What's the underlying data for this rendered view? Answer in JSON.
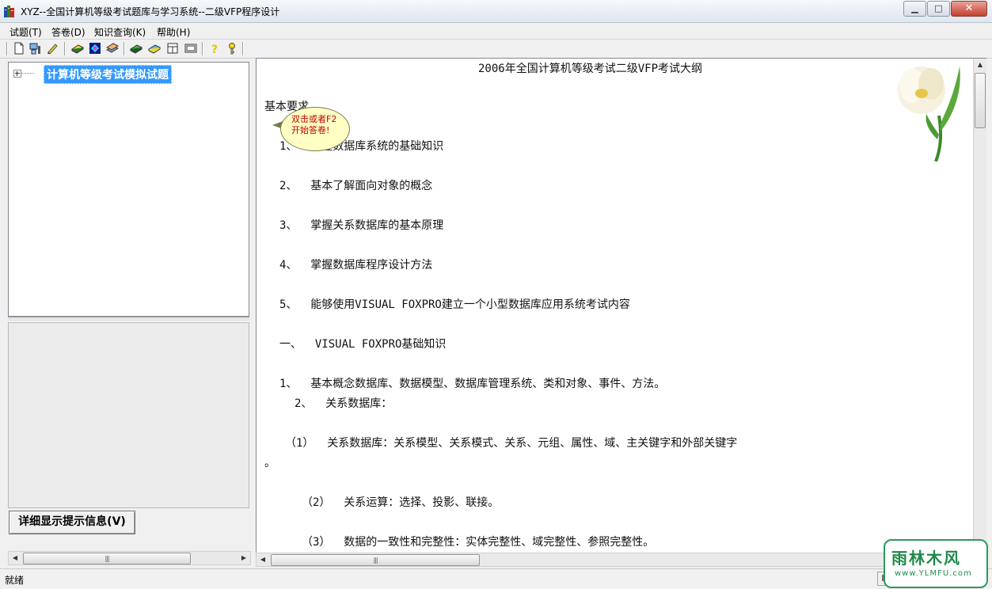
{
  "window": {
    "title": "XYZ--全国计算机等级考试题库与学习系统--二级VFP程序设计",
    "min_glyph": "▁",
    "max_glyph": "□",
    "close_glyph": "✕"
  },
  "menu": [
    {
      "label": "试题(T)"
    },
    {
      "label": "答卷(D)"
    },
    {
      "label": "知识查询(K)"
    },
    {
      "label": "帮助(H)"
    }
  ],
  "toolbar": {
    "icons": [
      "new-document-icon",
      "tools-icon",
      "highlight-pen-icon",
      "yellow-book-icon",
      "blue-book-icon",
      "stacked-books-icon",
      "green-book-icon",
      "cyan-book-icon",
      "window-icon",
      "panel-icon",
      "help-question-icon",
      "key-icon"
    ]
  },
  "tree": {
    "root_label": "计算机等级考试模拟试题"
  },
  "left": {
    "detail_button": "详细显示提示信息(V)",
    "scroll_grip": "|||"
  },
  "document": {
    "title": "2006年全国计算机等级考试二级VFP考试大纲",
    "lines": [
      "基本要求",
      "1、  掌握数据库系统的基础知识",
      "2、  基本了解面向对象的概念",
      "3、  掌握关系数据库的基本原理",
      "4、  掌握数据库程序设计方法",
      "5、  能够使用VISUAL FOXPRO建立一个小型数据库应用系统考试内容",
      "一、  VISUAL FOXPRO基础知识",
      "1、  基本概念数据库、数据模型、数据库管理系统、类和对象、事件、方法。",
      "2、  关系数据库：",
      "（1）  关系数据库：关系模型、关系模式、关系、元组、属性、域、主关键字和外部关键字",
      "。",
      "（2）  关系运算：选择、投影、联接。",
      "（3）  数据的一致性和完整性：实体完整性、域完整性、参照完整性。"
    ]
  },
  "tooltip": {
    "line1": "双击或者F2",
    "line2": "开始答卷!"
  },
  "status": {
    "text": "就绪",
    "cell": "I"
  },
  "watermark": {
    "main": "雨林木风",
    "sub": "www.YLMFU.com"
  },
  "colors": {
    "selection": "#3399ff",
    "tooltip_text": "#c00000",
    "watermark": "#1e8a4a"
  }
}
